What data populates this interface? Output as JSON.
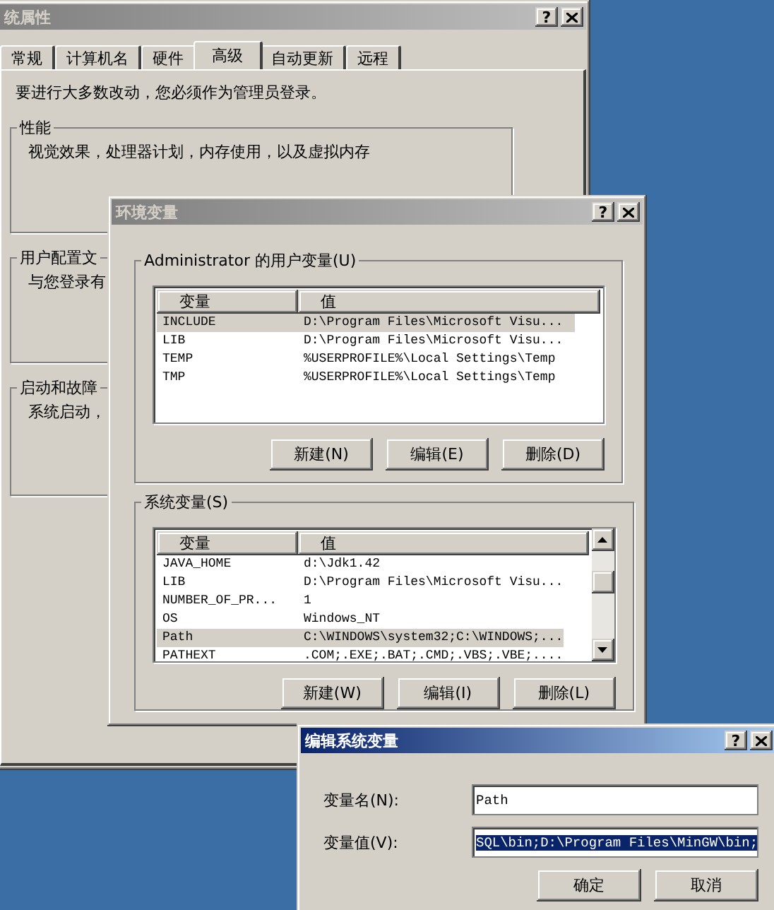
{
  "system_properties": {
    "title": "统属性",
    "active": false,
    "help": "?",
    "tabs": [
      {
        "label": "常规",
        "selected": false
      },
      {
        "label": "计算机名",
        "selected": false
      },
      {
        "label": "硬件",
        "selected": false
      },
      {
        "label": "高级",
        "selected": true
      },
      {
        "label": "自动更新",
        "selected": false
      },
      {
        "label": "远程",
        "selected": false
      }
    ],
    "notice": "要进行大多数改动，您必须作为管理员登录。",
    "groups": [
      {
        "title": "性能",
        "text": "视觉效果，处理器计划，内存使用，以及虚拟内存"
      },
      {
        "title": "用户配置文",
        "text": "与您登录有"
      },
      {
        "title": "启动和故障",
        "text": "系统启动，"
      }
    ]
  },
  "environment_variables": {
    "title": "环境变量",
    "active": false,
    "help": "?",
    "user_group": {
      "title": "Administrator 的用户变量(U)",
      "columns": [
        "变量",
        "值"
      ],
      "rows": [
        {
          "name": "INCLUDE",
          "value": "D:\\Program Files\\Microsoft Visu...",
          "selected": true
        },
        {
          "name": "LIB",
          "value": "D:\\Program Files\\Microsoft Visu...",
          "selected": false
        },
        {
          "name": "TEMP",
          "value": "%USERPROFILE%\\Local Settings\\Temp",
          "selected": false
        },
        {
          "name": "TMP",
          "value": "%USERPROFILE%\\Local Settings\\Temp",
          "selected": false
        }
      ],
      "buttons": [
        "新建(N)",
        "编辑(E)",
        "删除(D)"
      ]
    },
    "system_group": {
      "title": "系统变量(S)",
      "columns": [
        "变量",
        "值"
      ],
      "rows": [
        {
          "name": "JAVA_HOME",
          "value": "d:\\Jdk1.42",
          "selected": false
        },
        {
          "name": "LIB",
          "value": "D:\\Program Files\\Microsoft Visu...",
          "selected": false
        },
        {
          "name": "NUMBER_OF_PR...",
          "value": "1",
          "selected": false
        },
        {
          "name": "OS",
          "value": "Windows_NT",
          "selected": false
        },
        {
          "name": "Path",
          "value": "C:\\WINDOWS\\system32;C:\\WINDOWS;...",
          "selected": true
        },
        {
          "name": "PATHEXT",
          "value": ".COM;.EXE;.BAT;.CMD;.VBS;.VBE;....",
          "selected": false
        }
      ],
      "buttons": [
        "新建(W)",
        "编辑(I)",
        "删除(L)"
      ]
    }
  },
  "edit_dialog": {
    "title": "编辑系统变量",
    "active": true,
    "help": "?",
    "name_label": "变量名(N):",
    "name_value": "Path",
    "value_label": "变量值(V):",
    "value_value": "SQL\\bin;D:\\Program Files\\MinGW\\bin;",
    "value_selected": true,
    "buttons": [
      "确定",
      "取消"
    ]
  }
}
